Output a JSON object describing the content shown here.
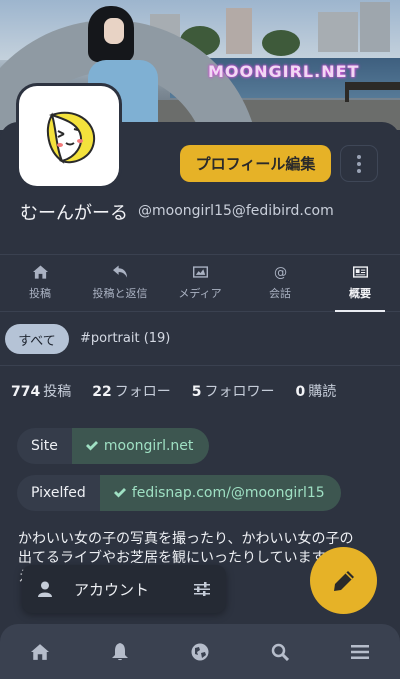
{
  "banner": {
    "watermark": "MOONGIRL.NET"
  },
  "profile": {
    "display_name": "むーんがーる",
    "account": "@moongirl15@fedibird.com",
    "edit_label": "プロフィール編集"
  },
  "tabs": [
    {
      "label": "投稿",
      "icon": "home-icon"
    },
    {
      "label": "投稿と返信",
      "icon": "reply-icon"
    },
    {
      "label": "メディア",
      "icon": "image-icon"
    },
    {
      "label": "会話",
      "icon": "at-icon"
    },
    {
      "label": "概要",
      "icon": "id-card-icon",
      "active": true
    }
  ],
  "filters": {
    "all": "すべて",
    "tag": "#portrait (19)"
  },
  "stats": {
    "posts_count": "774",
    "posts_label": "投稿",
    "following_count": "22",
    "following_label": "フォロー",
    "followers_count": "5",
    "followers_label": "フォロワー",
    "subscribe_count": "0",
    "subscribe_label": "購読"
  },
  "fields": [
    {
      "key": "Site",
      "value": "moongirl.net"
    },
    {
      "key": "Pixelfed",
      "value": "fedisnap.com/@moongirl15"
    }
  ],
  "bio": {
    "line1": "かわいい女の子の写真を撮ったり、かわいい女の子の",
    "line2": "出てるライブやお芝居を観にいったりしています",
    "line3": "え"
  },
  "account_popup": {
    "label": "アカウント"
  },
  "colors": {
    "accent": "#e6b227",
    "background": "#2d3340",
    "verified": "#9fe0c3"
  }
}
